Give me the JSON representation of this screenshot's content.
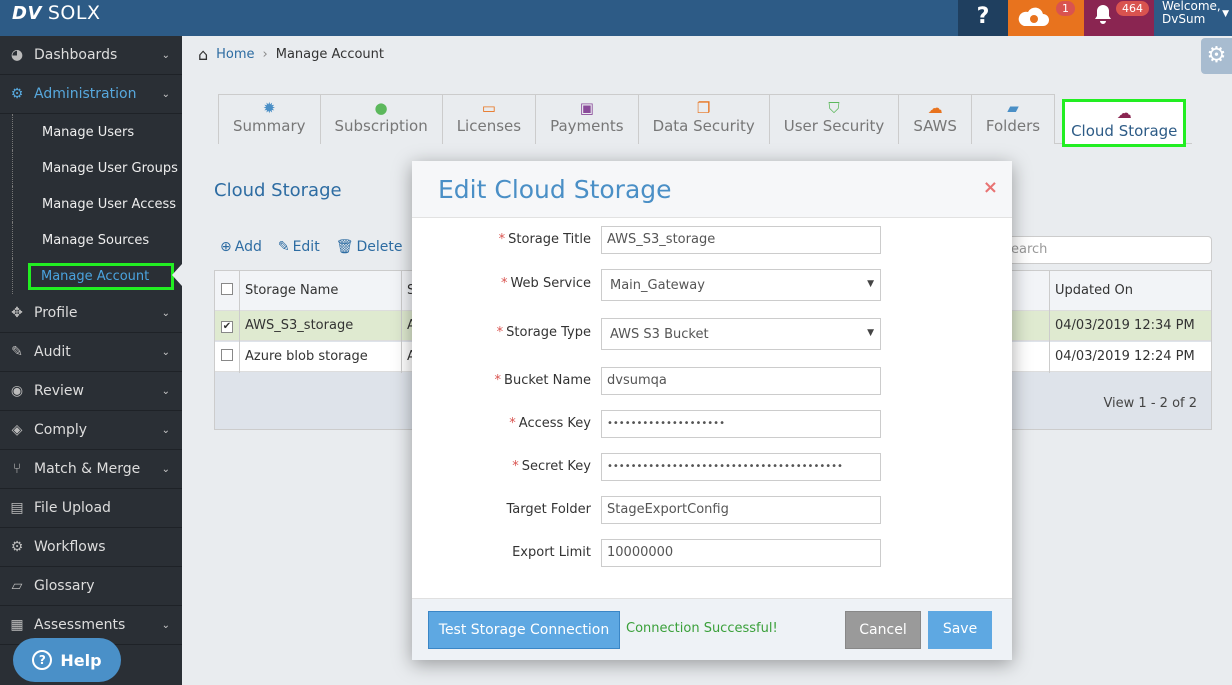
{
  "app": {
    "logo_mark": "DV",
    "logo_name": "SOLX"
  },
  "topbar": {
    "help_icon": "?",
    "cloud_badge": "1",
    "bell_badge": "464",
    "welcome": "Welcome,",
    "user": "DvSum"
  },
  "sidebar": {
    "items": [
      {
        "label": "Dashboards",
        "icon": "dashboard-icon"
      },
      {
        "label": "Administration",
        "icon": "cogs-icon"
      }
    ],
    "subitems": [
      "Manage Users",
      "Manage User Groups",
      "Manage User Access",
      "Manage Sources",
      "Manage Account"
    ],
    "items_after": [
      {
        "label": "Profile"
      },
      {
        "label": "Audit"
      },
      {
        "label": "Review"
      },
      {
        "label": "Comply"
      },
      {
        "label": "Match & Merge"
      },
      {
        "label": "File Upload"
      },
      {
        "label": "Workflows"
      },
      {
        "label": "Glossary"
      },
      {
        "label": "Assessments"
      }
    ],
    "help_label": "Help"
  },
  "breadcrumb": {
    "home": "Home",
    "current": "Manage Account"
  },
  "tabs": [
    "Summary",
    "Subscription",
    "Licenses",
    "Payments",
    "Data Security",
    "User Security",
    "SAWS",
    "Folders",
    "Cloud Storage"
  ],
  "panel": {
    "title": "Cloud Storage",
    "toolbar": {
      "add": "Add",
      "edit": "Edit",
      "delete": "Delete"
    },
    "search_placeholder": "earch",
    "columns": {
      "name": "Storage Name",
      "s": "S",
      "updated": "Updated On"
    },
    "rows": [
      {
        "name": "AWS_S3_storage",
        "s": "A",
        "updated": "04/03/2019 12:34 PM",
        "checked": true
      },
      {
        "name": "Azure blob storage",
        "s": "A",
        "updated": "04/03/2019 12:24 PM",
        "checked": false
      }
    ],
    "pager": "View 1 - 2 of 2"
  },
  "modal": {
    "title": "Edit Cloud Storage",
    "close": "×",
    "fields": {
      "storage_title": {
        "label": "Storage Title",
        "value": "AWS_S3_storage"
      },
      "web_service": {
        "label": "Web Service",
        "value": "Main_Gateway"
      },
      "storage_type": {
        "label": "Storage Type",
        "value": "AWS S3 Bucket"
      },
      "bucket_name": {
        "label": "Bucket Name",
        "value": "dvsumqa"
      },
      "access_key": {
        "label": "Access Key",
        "value": "••••••••••••••••••••"
      },
      "secret_key": {
        "label": "Secret Key",
        "value": "••••••••••••••••••••••••••••••••••••••••"
      },
      "target_folder": {
        "label": "Target Folder",
        "value": "StageExportConfig"
      },
      "export_limit": {
        "label": "Export Limit",
        "value": "10000000"
      }
    },
    "buttons": {
      "test": "Test Storage Connection",
      "cancel": "Cancel",
      "save": "Save"
    },
    "connection_msg": "Connection Successful!"
  }
}
